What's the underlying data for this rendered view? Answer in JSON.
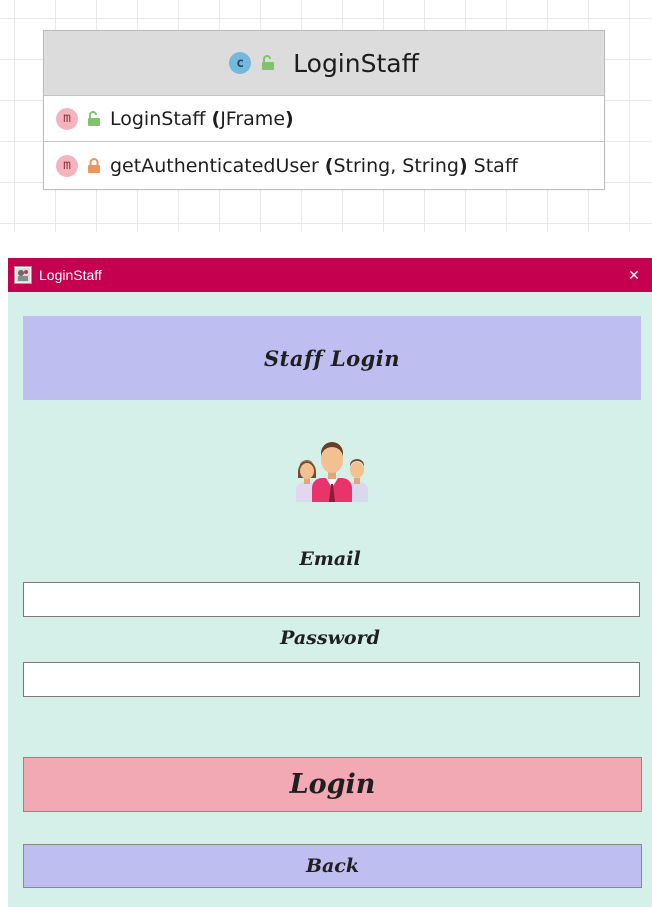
{
  "uml": {
    "class_badge": "c",
    "class_name": "LoginStaff",
    "members": [
      {
        "badge": "m",
        "visibility_icon": "unlocked-public-icon",
        "name": "LoginStaff",
        "params": "JFrame",
        "return_type": ""
      },
      {
        "badge": "m",
        "visibility_icon": "locked-private-icon",
        "name": "getAuthenticatedUser",
        "params": "String, String",
        "return_type": "Staff"
      }
    ]
  },
  "window": {
    "title": "LoginStaff",
    "close_glyph": "✕",
    "header": "Staff Login",
    "email_label": "Email",
    "email_value": "",
    "password_label": "Password",
    "password_value": "",
    "login_button": "Login",
    "back_button": "Back"
  },
  "colors": {
    "titlebar": "#c4004f",
    "window_bg": "#d4f0e8",
    "header_panel": "#bebef0",
    "login_button": "#f2a9b4",
    "back_button": "#bebef0"
  }
}
